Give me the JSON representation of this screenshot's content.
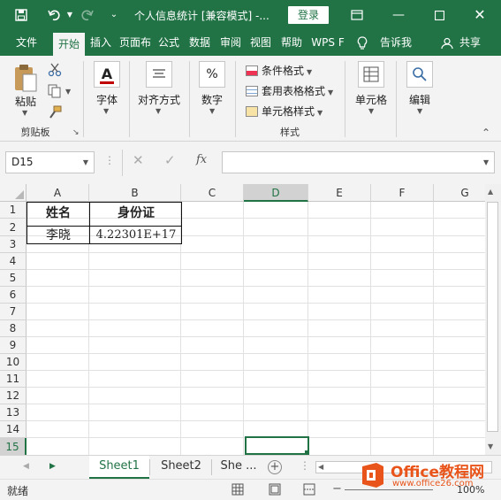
{
  "titlebar": {
    "title": "个人信息统计  [兼容模式]  -...",
    "login": "登录"
  },
  "tabs": [
    "文件",
    "开始",
    "插入",
    "页面布",
    "公式",
    "数据",
    "审阅",
    "视图",
    "帮助",
    "WPS F"
  ],
  "tell_me": "告诉我",
  "share": "共享",
  "ribbon": {
    "clipboard": {
      "paste": "粘贴",
      "group": "剪贴板"
    },
    "font": {
      "label": "字体"
    },
    "align": {
      "label": "对齐方式"
    },
    "number": {
      "label": "数字",
      "icon_text": "%"
    },
    "styles": {
      "conditional": "条件格式",
      "table_format": "套用表格格式",
      "cell_style": "单元格样式",
      "group": "样式"
    },
    "cells": {
      "label": "单元格"
    },
    "edit": {
      "label": "编辑"
    }
  },
  "formula_bar": {
    "name_box": "D15",
    "fx": "fx",
    "value": ""
  },
  "columns": [
    "A",
    "B",
    "C",
    "D",
    "E",
    "F",
    "G"
  ],
  "selected_column": "D",
  "rows": [
    "1",
    "2",
    "3",
    "4",
    "5",
    "6",
    "7",
    "8",
    "9",
    "10",
    "11",
    "12",
    "13",
    "14",
    "15"
  ],
  "selected_row": "15",
  "cells": {
    "A1": "姓名",
    "B1": "身份证",
    "A2": "李晓",
    "B2": "4.22301E+17"
  },
  "sheets": [
    "Sheet1",
    "Sheet2",
    "She ..."
  ],
  "active_sheet": "Sheet1",
  "status": {
    "ready": "就绪",
    "zoom": "100%"
  },
  "watermark": {
    "brand": "Office教程网",
    "url": "www.office26.com"
  },
  "colors": {
    "accent": "#217346",
    "watermark_orange": "#e8541a"
  }
}
